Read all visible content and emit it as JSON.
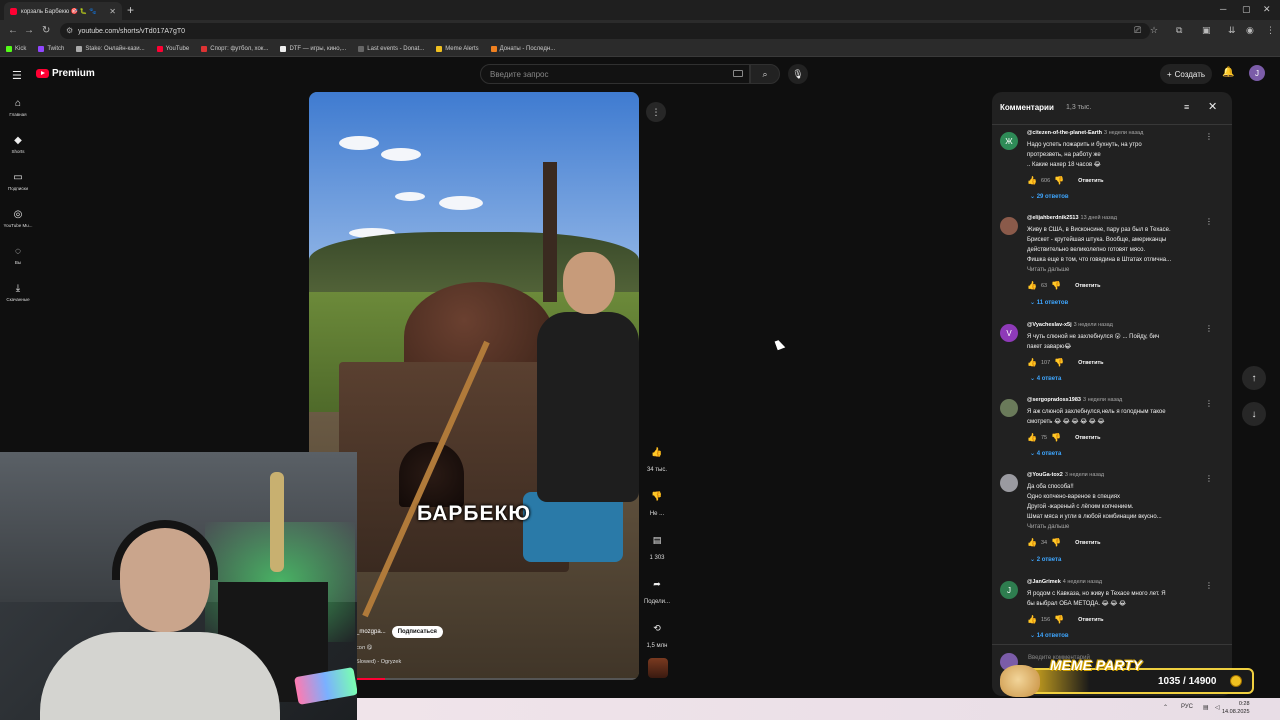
{
  "browser": {
    "tab_title": "корзаль Барбекю 🎯 🐛 🐾",
    "url": "youtube.com/shorts/vTd017A7gT0",
    "bookmarks": [
      "Kick",
      "Twitch",
      "Stake: Онлайн-кази...",
      "YouTube",
      "Спорт: футбол, хок...",
      "DTF — игры, кино,...",
      "Last events - Donat...",
      "Meme Alerts",
      "Донаты - Последн..."
    ]
  },
  "youtube": {
    "logo_text": "Premium",
    "search_placeholder": "Введите запрос",
    "create_label": "Создать",
    "user_initial": "J",
    "nav": [
      {
        "label": "Главная",
        "icon": "home-icon"
      },
      {
        "label": "Shorts",
        "icon": "shorts-icon"
      },
      {
        "label": "Подписки",
        "icon": "subscriptions-icon"
      },
      {
        "label": "YouTube Mu...",
        "icon": "youtube-music-icon"
      },
      {
        "label": "Вы",
        "icon": "you-icon"
      },
      {
        "label": "Скачанные",
        "icon": "downloads-icon"
      }
    ]
  },
  "video": {
    "caption": "БАРБЕКЮ",
    "channel": "_mozgpa...",
    "subscribe_label": "Подписаться",
    "desc_line": "сол 😋",
    "sound": "Slowed) - Ogryzek",
    "progress": 0.1,
    "actions": {
      "likes": "34 тыс.",
      "dislike": "Не ...",
      "comments": "1 303",
      "share": "Подели...",
      "remix": "1,5 млн"
    }
  },
  "comments": {
    "title": "Комментарии",
    "count": "1,3 тыс.",
    "input_placeholder": "Введите комментарий",
    "items": [
      {
        "author": "@citezen-of-the-planet-Earth",
        "time": "3 недели назад",
        "avatar_letter": "Ж",
        "avatar_color": "#2e8b57",
        "lines": [
          "Надо успеть пожарить и бухнуть, на утро",
          "протрезветь, на работу же",
          ".. Какие нахер 18 часов 😂"
        ],
        "read_more": "",
        "likes": "606",
        "reply_label": "Ответить",
        "replies": "29 ответов"
      },
      {
        "author": "@elijahberdnik2513",
        "time": "13 дней назад",
        "avatar_letter": "",
        "avatar_color": "#8a5a4a",
        "lines": [
          "Живу в США, в Висконсине, пару раз был в Техасе.",
          "Брискет - крутейшая штука. Вообще, американцы",
          "действительно великолепно готовят мясо.",
          "Фишка еще в том, что говядина в Штатах отлична..."
        ],
        "read_more": "Читать дальше",
        "likes": "63",
        "reply_label": "Ответить",
        "replies": "11 ответов"
      },
      {
        "author": "@Vyacheslav-x5j",
        "time": "3 недели назад",
        "avatar_letter": "V",
        "avatar_color": "#8e3ab8",
        "lines": [
          "Я чуть слюной не захлебнулся 😮 ... Пойду, бич",
          "пакет заварю😂"
        ],
        "read_more": "",
        "likes": "107",
        "reply_label": "Ответить",
        "replies": "4 ответа"
      },
      {
        "author": "@sergopradoss1983",
        "time": "3 недели назад",
        "avatar_letter": "",
        "avatar_color": "#6a7a5a",
        "lines": [
          "Я аж слюной захлебнулся,нель я голодным такое",
          "смотреть 😂 😂 😂 😂 😂 😂"
        ],
        "read_more": "",
        "likes": "75",
        "reply_label": "Ответить",
        "replies": "4 ответа"
      },
      {
        "author": "@YouGa-tox2",
        "time": "3 недели назад",
        "avatar_letter": "",
        "avatar_color": "#9a9aa0",
        "lines": [
          "Да оба способа!!",
          "   Одно копчено-вареное в специях",
          "Другой -жареный с лёгким копчением.",
          "   Шмат мяса и угли в любой комбинации вкусно..."
        ],
        "read_more": "Читать дальше",
        "likes": "34",
        "reply_label": "Ответить",
        "replies": "2 ответа"
      },
      {
        "author": "@JanGrimek",
        "time": "4 недели назад",
        "avatar_letter": "J",
        "avatar_color": "#2e7d4f",
        "lines": [
          "Я родом с Кавказа, но живу в Техасе много лет. Я",
          "бы выбрал ОБА МЕТОДА. 😂 😂 😂"
        ],
        "read_more": "",
        "likes": "156",
        "reply_label": "Ответить",
        "replies": "14 ответов"
      }
    ]
  },
  "overlay": {
    "title": "MEME PARTY",
    "count": "1035 / 14900"
  },
  "taskbar": {
    "lang": "РУС",
    "time": "0:28",
    "date": "14.08.2025"
  }
}
